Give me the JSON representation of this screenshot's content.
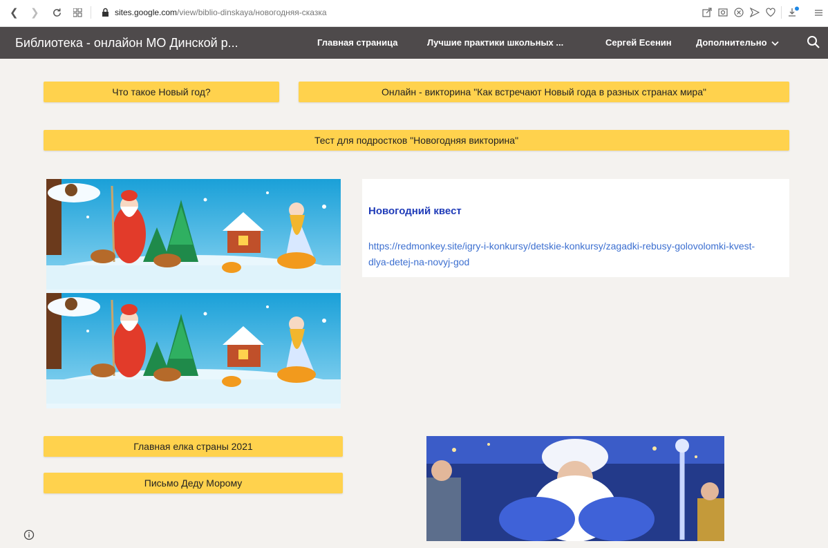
{
  "browser": {
    "url_host": "sites.google.com",
    "url_path": "/view/biblio-dinskaya/новогодняя-сказка"
  },
  "header": {
    "title": "Библиотека - онлайон МО Динской р...",
    "nav": [
      "Главная страница",
      "Лучшие практики школьных ...",
      "Сергей Есенин",
      "Дополнительно"
    ]
  },
  "buttons": {
    "new_year": "Что такое Новый год?",
    "quiz_online": "Онлайн - викторина \"Как встречают Новый года в разных странах мира\"",
    "teen_test": "Тест для подростков \"Новогодняя викторина\"",
    "main_tree": "Главная елка страны 2021",
    "letter": "Письмо Деду Морому"
  },
  "quest": {
    "title": "Новогодний квест",
    "link": "https://redmonkey.site/igry-i-konkursy/detskie-konkursy/zagadki-rebusy-golovolomki-kvest-dlya-detej-na-novyj-god"
  },
  "colors": {
    "header_bg": "#4e4a4b",
    "button_bg": "#ffd24d",
    "page_bg": "#f4f2ef",
    "quest_title": "#1f3bb8",
    "link": "#3c6fd0"
  }
}
